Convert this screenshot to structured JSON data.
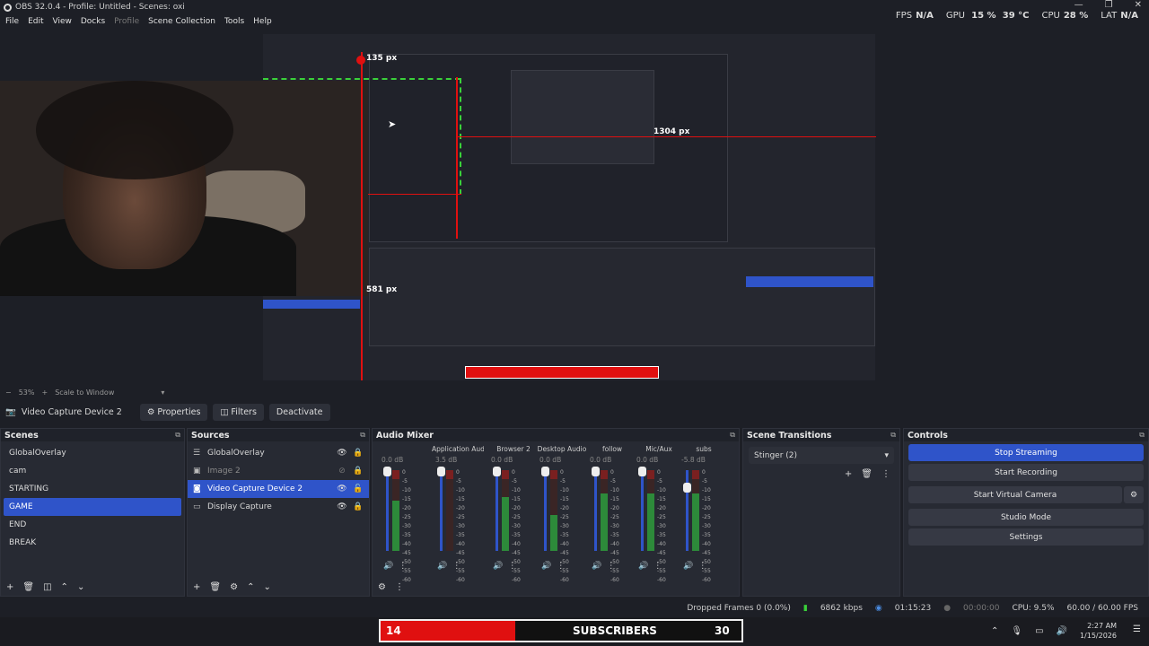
{
  "window": {
    "title": "OBS 32.0.4 - Profile: Untitled - Scenes: oxi"
  },
  "menu": [
    "File",
    "Edit",
    "View",
    "Docks",
    "Profile",
    "Scene Collection",
    "Tools",
    "Help"
  ],
  "stats": {
    "fps_label": "FPS",
    "fps": "N/A",
    "gpu_label": "GPU",
    "gpu": "15 %",
    "gpu_temp": "39 °C",
    "cpu_label": "CPU",
    "cpu": "28 %",
    "lat_label": "LAT",
    "lat": "N/A"
  },
  "preview": {
    "measure_top": "135 px",
    "measure_right": "1304 px",
    "measure_left": "581 px"
  },
  "zoom": {
    "minus": "−",
    "value": "53%",
    "plus": "+",
    "mode": "Scale to Window"
  },
  "toolbar": {
    "source_name": "Video Capture Device 2",
    "properties": "Properties",
    "filters": "Filters",
    "deactivate": "Deactivate"
  },
  "scenes": {
    "title": "Scenes",
    "items": [
      "GlobalOverlay",
      "cam",
      "STARTING",
      "GAME",
      "END",
      "BREAK"
    ],
    "selected": "GAME"
  },
  "sources": {
    "title": "Sources",
    "items": [
      {
        "name": "GlobalOverlay",
        "icon": "list-icon"
      },
      {
        "name": "Image 2",
        "icon": "image-icon"
      },
      {
        "name": "Video Capture Device 2",
        "icon": "camera-icon"
      },
      {
        "name": "Display Capture",
        "icon": "monitor-icon"
      }
    ]
  },
  "mixer": {
    "title": "Audio Mixer",
    "channels": [
      {
        "name": "",
        "db": "0.0 dB",
        "level": 0.7,
        "fader": 0.0
      },
      {
        "name": "Application Audio (",
        "db": "3.5 dB",
        "level": 0.0,
        "fader": 0.0
      },
      {
        "name": "Browser 2",
        "db": "0.0 dB",
        "level": 0.75,
        "fader": 0.0
      },
      {
        "name": "Desktop Audio",
        "db": "0.0 dB",
        "level": 0.5,
        "fader": 0.0
      },
      {
        "name": "follow",
        "db": "0.0 dB",
        "level": 0.8,
        "fader": 0.0
      },
      {
        "name": "Mic/Aux",
        "db": "0.0 dB",
        "level": 0.8,
        "fader": 0.0
      },
      {
        "name": "subs",
        "db": "-5.8 dB",
        "level": 0.8,
        "fader": 0.2
      }
    ],
    "scale": [
      "0",
      "-5",
      "-10",
      "-15",
      "-20",
      "-25",
      "-30",
      "-35",
      "-40",
      "-45",
      "-50",
      "-55",
      "-60"
    ]
  },
  "transitions": {
    "title": "Scene Transitions",
    "selected": "Stinger (2)"
  },
  "controls": {
    "title": "Controls",
    "stop_streaming": "Stop Streaming",
    "start_recording": "Start Recording",
    "start_virtual_camera": "Start Virtual Camera",
    "studio_mode": "Studio Mode",
    "settings": "Settings"
  },
  "status": {
    "dropped": "Dropped Frames 0 (0.0%)",
    "kbps": "6862 kbps",
    "stream_time": "01:15:23",
    "rec_time": "00:00:00",
    "cpu": "CPU: 9.5%",
    "fps": "60.00 / 60.00 FPS"
  },
  "overlay": {
    "left": "14",
    "mid": "SUBSCRIBERS",
    "right": "30"
  },
  "clock": {
    "time": "2:27 AM",
    "date": "1/15/2026"
  },
  "colors": {
    "accent": "#2f54c9",
    "red": "#e01010",
    "green": "#3ad13a"
  }
}
